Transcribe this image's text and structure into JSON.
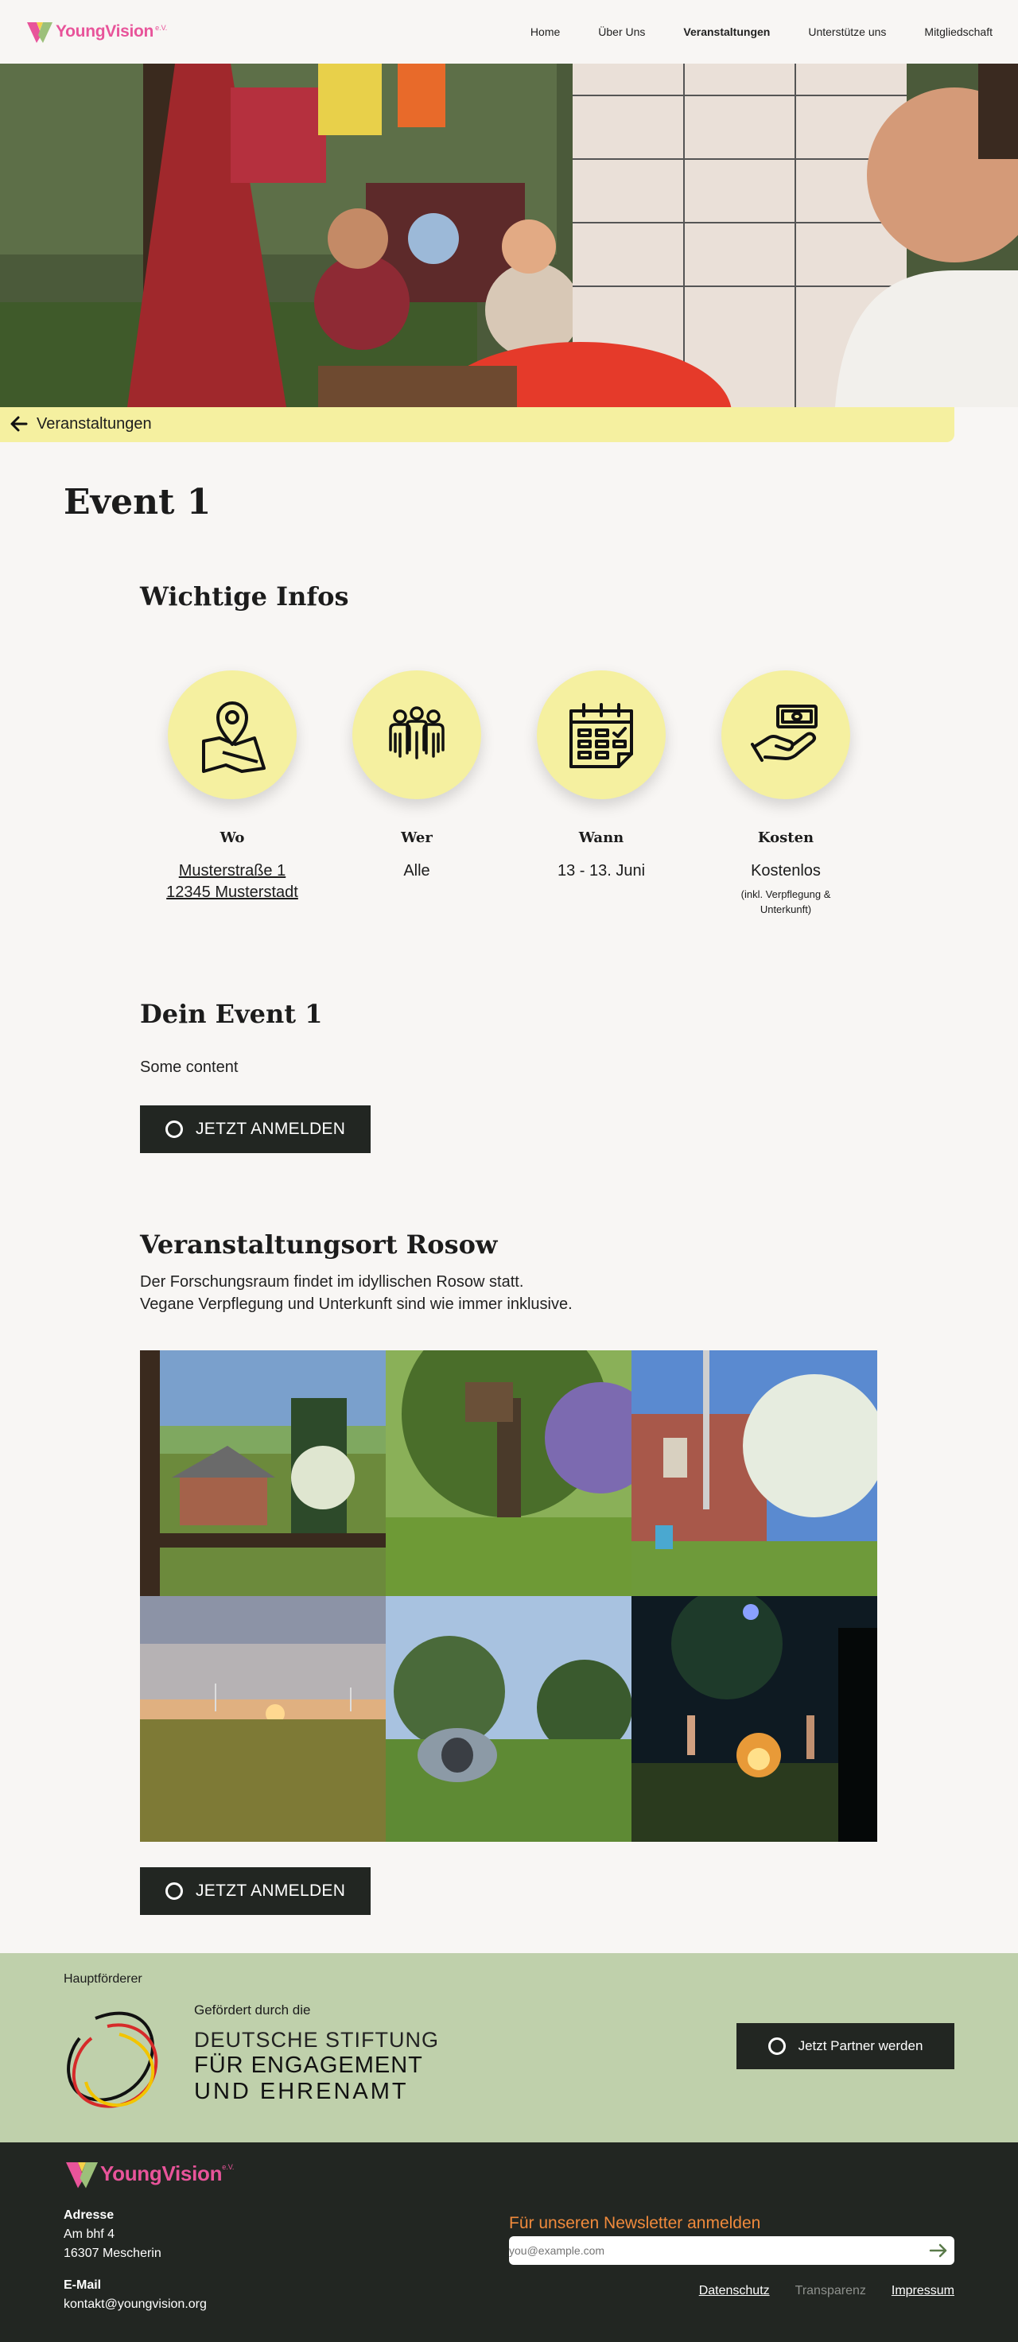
{
  "nav": {
    "logo_text": "YoungVision",
    "logo_suffix": "e.V.",
    "links": [
      "Home",
      "Über Uns",
      "Veranstaltungen",
      "Unterstütze uns",
      "Mitgliedschaft"
    ],
    "active": "Veranstaltungen"
  },
  "back": {
    "label": "Veranstaltungen"
  },
  "event": {
    "title": "Event 1"
  },
  "infos": {
    "heading": "Wichtige Infos",
    "items": [
      {
        "icon": "map-pin-icon",
        "label": "Wo",
        "value_line1": "Musterstraße 1",
        "value_line2": "12345 Musterstadt"
      },
      {
        "icon": "people-icon",
        "label": "Wer",
        "value": "Alle"
      },
      {
        "icon": "calendar-icon",
        "label": "Wann",
        "value": "13 - 13. Juni"
      },
      {
        "icon": "money-hand-icon",
        "label": "Kosten",
        "value": "Kostenlos",
        "note_line1": "(inkl. Verpflegung &",
        "note_line2": "Unterkunft)"
      }
    ]
  },
  "details": {
    "heading": "Dein Event 1",
    "content": "Some content",
    "cta": "JETZT ANMELDEN"
  },
  "location": {
    "heading": "Veranstaltungsort Rosow",
    "line1": "Der Forschungsraum findet im idyllischen Rosow statt.",
    "line2": "Vegane Verpflegung und Unterkunft sind wie immer inklusive.",
    "cta": "JETZT ANMELDEN"
  },
  "sponsor": {
    "label": "Hauptförderer",
    "funded_by": "Gefördert durch die",
    "org_line1": "DEUTSCHE STIFTUNG",
    "org_line2": "FÜR ENGAGEMENT",
    "org_line3": "UND EHRENAMT",
    "partner_cta": "Jetzt Partner werden"
  },
  "footer": {
    "address_heading": "Adresse",
    "address_line1": "Am bhf 4",
    "address_line2": "16307 Mescherin",
    "email_heading": "E-Mail",
    "email": "kontakt@youngvision.org",
    "newsletter_title": "Für unseren Newsletter anmelden",
    "newsletter_placeholder": "you@example.com",
    "links": {
      "privacy": "Datenschutz",
      "transparency": "Transparenz",
      "imprint": "Impressum"
    }
  },
  "colors": {
    "accent_yellow": "#f5f0a0",
    "dark": "#222622",
    "sponsor_green": "#bfd0ab",
    "brand_pink": "#e8549a",
    "newsletter_orange": "#f08a3c"
  }
}
